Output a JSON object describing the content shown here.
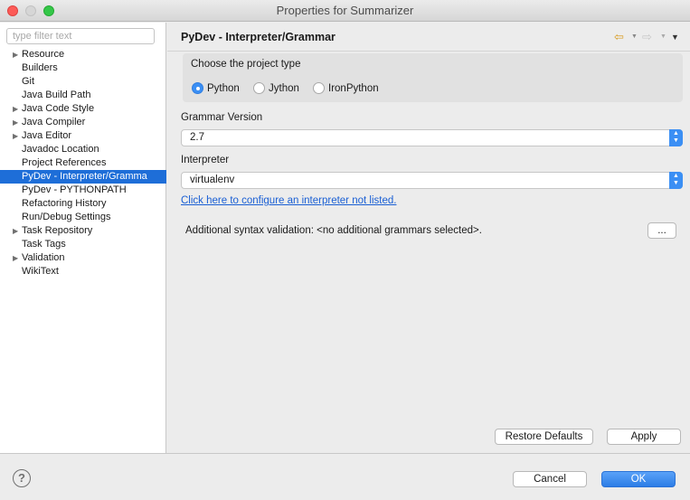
{
  "window": {
    "title": "Properties for Summarizer"
  },
  "left": {
    "filter_placeholder": "type filter text",
    "items": [
      {
        "label": "Resource",
        "expandable": true
      },
      {
        "label": "Builders",
        "expandable": false
      },
      {
        "label": "Git",
        "expandable": false
      },
      {
        "label": "Java Build Path",
        "expandable": false
      },
      {
        "label": "Java Code Style",
        "expandable": true
      },
      {
        "label": "Java Compiler",
        "expandable": true
      },
      {
        "label": "Java Editor",
        "expandable": true
      },
      {
        "label": "Javadoc Location",
        "expandable": false
      },
      {
        "label": "Project References",
        "expandable": false
      },
      {
        "label": "PyDev - Interpreter/Gramma",
        "expandable": false,
        "selected": true
      },
      {
        "label": "PyDev - PYTHONPATH",
        "expandable": false
      },
      {
        "label": "Refactoring History",
        "expandable": false
      },
      {
        "label": "Run/Debug Settings",
        "expandable": false
      },
      {
        "label": "Task Repository",
        "expandable": true
      },
      {
        "label": "Task Tags",
        "expandable": false
      },
      {
        "label": "Validation",
        "expandable": true
      },
      {
        "label": "WikiText",
        "expandable": false
      }
    ]
  },
  "page": {
    "title": "PyDev - Interpreter/Grammar",
    "project_type": {
      "label": "Choose the project type",
      "options": [
        "Python",
        "Jython",
        "IronPython"
      ],
      "selected": "Python"
    },
    "grammar": {
      "label": "Grammar Version",
      "value": "2.7"
    },
    "interpreter": {
      "label": "Interpreter",
      "value": "virtualenv"
    },
    "configure_link": "Click here to configure an interpreter not listed.",
    "syntax_validation": "Additional syntax validation: <no additional grammars selected>.",
    "ellipsis_button": "...",
    "restore_defaults": "Restore Defaults",
    "apply": "Apply"
  },
  "footer": {
    "cancel": "Cancel",
    "ok": "OK",
    "help": "?"
  },
  "colors": {
    "accent": "#3b8ff4",
    "selection": "#1e6ed8",
    "link": "#1a5fd4"
  }
}
